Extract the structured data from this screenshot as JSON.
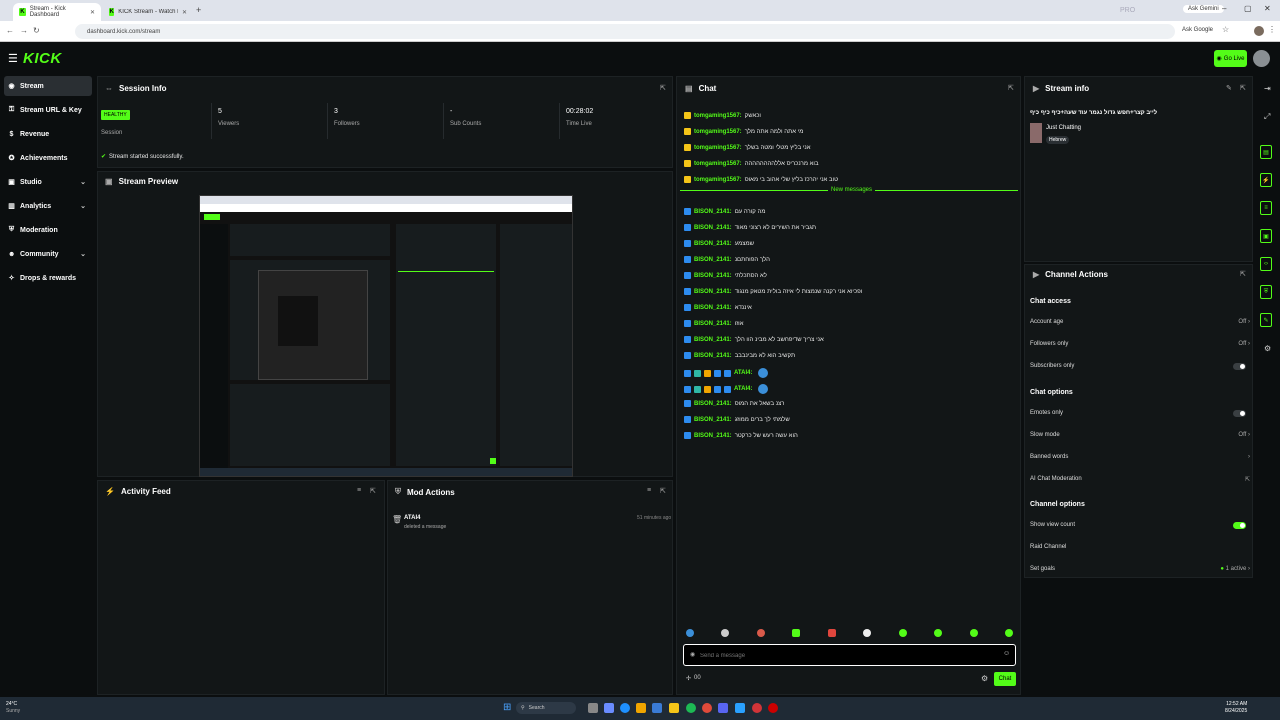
{
  "browser": {
    "tabs": [
      {
        "title": "Stream - Kick Dashboard"
      },
      {
        "title": "KICK Stream - Watch Live on Ki..."
      }
    ],
    "url": "dashboard.kick.com/stream",
    "ask_google": "Ask Google",
    "profile": "Ask Gemini",
    "ghost_text": "PRO"
  },
  "header": {
    "logo": "KICK",
    "go_live": "Go Live"
  },
  "sidebar": {
    "items": [
      {
        "label": "Stream",
        "icon": "broadcast-icon"
      },
      {
        "label": "Stream URL & Key",
        "icon": "key-icon"
      },
      {
        "label": "Revenue",
        "icon": "dollar-icon"
      },
      {
        "label": "Achievements",
        "icon": "trophy-icon"
      },
      {
        "label": "Studio",
        "icon": "studio-icon"
      },
      {
        "label": "Analytics",
        "icon": "chart-icon"
      },
      {
        "label": "Moderation",
        "icon": "shield-icon"
      },
      {
        "label": "Community",
        "icon": "people-icon"
      },
      {
        "label": "Drops & rewards",
        "icon": "gift-icon"
      }
    ]
  },
  "session": {
    "title": "Session Info",
    "badge": "HEALTHY",
    "badge_label": "Session",
    "viewers": "5",
    "viewers_label": "Viewers",
    "followers": "3",
    "followers_label": "Followers",
    "subs": "-",
    "subs_label": "Sub Counts",
    "time": "00:28:02",
    "time_label": "Time Live",
    "status": "Stream started successfully."
  },
  "preview": {
    "title": "Stream Preview"
  },
  "activity": {
    "title": "Activity Feed"
  },
  "mod": {
    "title": "Mod Actions",
    "user": "ATAI4",
    "action": "deleted a message",
    "time": "51 minutes ago"
  },
  "chat": {
    "title": "Chat",
    "new_messages": "New messages",
    "messages": [
      {
        "user": "tomgaming1567:",
        "text": "וכאשק"
      },
      {
        "user": "tomgaming1567:",
        "text": "מי אתה ולמה אתה מלך"
      },
      {
        "user": "tomgaming1567:",
        "text": "אני בליץ מטלי ומטה בשלך"
      },
      {
        "user": "tomgaming1567:",
        "text": "בוא מרנכריס אללהההההההה"
      },
      {
        "user": "tomgaming1567:",
        "text": "טוב אני יהרכז בליץ שלי אהוב בי מאוס"
      },
      {
        "user": "BISON_2141:",
        "text": "מה קורה עם"
      },
      {
        "user": "BISON_2141:",
        "text": "תגביר את השירים לא רצוני מאוד"
      },
      {
        "user": "BISON_2141:",
        "text": "שמצמע"
      },
      {
        "user": "BISON_2141:",
        "text": "הלך הפוחתםנ"
      },
      {
        "user": "BISON_2141:",
        "text": "לא הסתכלתי"
      },
      {
        "user": "BISON_2141:",
        "text": "ופכיוא אני רקנה שנמצות לי איזה בולית מטאק מנגוד"
      },
      {
        "user": "BISON_2141:",
        "text": "איננדא"
      },
      {
        "user": "BISON_2141:",
        "text": "אוזו"
      },
      {
        "user": "BISON_2141:",
        "text": "אני צריך שדיפחשב לא מבינ הוו הלך"
      },
      {
        "user": "BISON_2141:",
        "text": "תקשיב הוא לא מבינבבב"
      },
      {
        "user": "ATAI4:",
        "text": ""
      },
      {
        "user": "ATAI4:",
        "text": ""
      },
      {
        "user": "BISON_2141:",
        "text": "רצנ בשאל את המוס"
      },
      {
        "user": "BISON_2141:",
        "text": "שלמתי לך ברים ממוזג"
      },
      {
        "user": "BISON_2141:",
        "text": "הוא עשה רעש של כרקטר"
      }
    ],
    "input_placeholder": "Send a message",
    "points": "00",
    "send": "Chat"
  },
  "stream_info": {
    "title": "Stream info",
    "stream_title": "לייב קצר+חפש גדול נגמר עוד שעה+כיף כיף כיף",
    "category": "Just Chatting",
    "language": "Hebrew"
  },
  "channel_actions": {
    "title": "Channel Actions",
    "chat_access": "Chat access",
    "account_age": "Account age",
    "account_age_val": "Off",
    "followers_only": "Followers only",
    "followers_only_val": "Off",
    "subscribers_only": "Subscribers only",
    "chat_options": "Chat options",
    "emotes_only": "Emotes only",
    "slow_mode": "Slow mode",
    "slow_mode_val": "Off",
    "banned_words": "Banned words",
    "ai_mod": "AI Chat Moderation",
    "channel_options": "Channel options",
    "show_view_count": "Show view count",
    "raid": "Raid Channel",
    "goals": "Set goals",
    "goals_val": "1 active"
  },
  "taskbar": {
    "weather": "24°C",
    "weather_sub": "Sunny",
    "search": "Search",
    "time": "12:52 AM",
    "date": "8/24/2025"
  },
  "colors": {
    "accent": "#53fc18",
    "bg": "#0b0e0f",
    "panel": "#121617"
  }
}
